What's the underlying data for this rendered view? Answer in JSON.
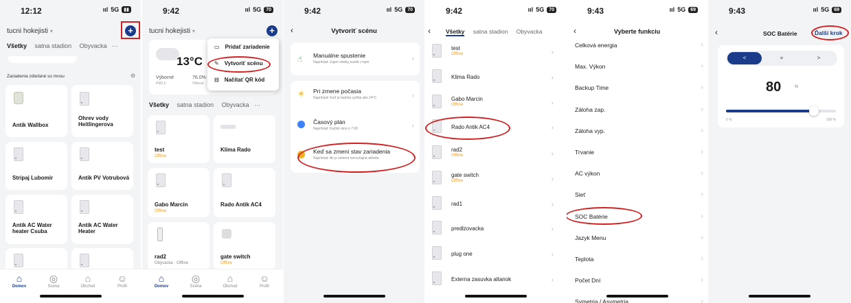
{
  "p1": {
    "time": "12:12",
    "net": "5G",
    "home_name": "tucni hokejisti",
    "tabs": [
      "Všetky",
      "satna stadion",
      "Obyvacka"
    ],
    "tab_more": "···",
    "shared_title": "Zariadenia zdieľané so mnou",
    "devices": [
      {
        "name": "Antik Wallbox"
      },
      {
        "name": "Ohrev vody Heitlingerova"
      },
      {
        "name": "Stripaj Lubomir"
      },
      {
        "name": "Antik PV Votrubová"
      },
      {
        "name": "Antik AC Water heater Csuba"
      },
      {
        "name": "Antik AC Water Heater"
      }
    ],
    "nav": [
      "Domov",
      "Scéna",
      "Obchod",
      "Profil"
    ]
  },
  "p2": {
    "time": "9:42",
    "net": "5G",
    "batt": "70",
    "home_name": "tucni hokejisti",
    "weather_temp": "13°C",
    "weather_l1": "Výborné",
    "weather_l2": "PM2,5",
    "weather_r1": "76.0%",
    "weather_r2": "Vlhkosť",
    "menu": [
      "Pridať zariadenie",
      "Vytvoriť scénu",
      "Načítať QR kód"
    ],
    "tabs": [
      "Všetky",
      "satna stadion",
      "Obyvacka"
    ],
    "tab_more": "···",
    "devices": [
      {
        "name": "test",
        "status": "Offline"
      },
      {
        "name": "Klima Rado",
        "status": ""
      },
      {
        "name": "Gabo Marcin",
        "status": "Offline"
      },
      {
        "name": "Rado Antik AC4",
        "status": ""
      },
      {
        "name": "rad2",
        "status": "Obývacka · Offline"
      },
      {
        "name": "gate switch",
        "status": "Offline"
      }
    ],
    "nav": [
      "Domov",
      "Scéna",
      "Obchod",
      "Profil"
    ]
  },
  "p3": {
    "time": "9:42",
    "net": "5G",
    "batt": "70",
    "title": "Vytvoriť scénu",
    "opt1_title": "Manuálne spustenie",
    "opt1_sub": "Napríklad: Zapni všetky svetlá v byte",
    "opt2_title": "Pri zmene počasia",
    "opt2_sub": "Napríklad: Keď je teplota vyššia ako 24°C",
    "opt3_title": "Časový plán",
    "opt3_sub": "Napríklad: Každé ráno o 7:00",
    "opt4_title": "Keď sa zmení stav zariadenia",
    "opt4_sub": "Napríklad: Ak je zistená nezvyčajná aktivita"
  },
  "p4": {
    "time": "9:42",
    "net": "5G",
    "batt": "70",
    "tabs": [
      "Všetky",
      "satna stadion",
      "Obyvacka"
    ],
    "devices": [
      {
        "name": "test",
        "status": "Offline"
      },
      {
        "name": "Klima Rado",
        "status": ""
      },
      {
        "name": "Gabo Marcin",
        "status": "Offline"
      },
      {
        "name": "Rado Antik AC4",
        "status": ""
      },
      {
        "name": "rad2",
        "status": "Offline"
      },
      {
        "name": "gate switch",
        "status": "Offline"
      },
      {
        "name": "rad1",
        "status": ""
      },
      {
        "name": "predlzovacka",
        "status": ""
      },
      {
        "name": "plug one",
        "status": ""
      },
      {
        "name": "Externa zasuvka altanok",
        "status": ""
      }
    ]
  },
  "p5": {
    "time": "9:43",
    "net": "5G",
    "batt": "69",
    "title": "Vyberte funkciu",
    "items": [
      "Celková energia",
      "Max. Výkon",
      "Backup Time",
      "Záloha zap.",
      "Záloha vyp.",
      "Trvanie",
      "AC výkon",
      "Sieť",
      "SOC Batérie",
      "Jazyk Menu",
      "Teplota",
      "Počet Dní",
      "Symetria / Asymetria"
    ]
  },
  "p6": {
    "time": "9:43",
    "net": "5G",
    "batt": "69",
    "title": "SOC Batérie",
    "next": "Ďalší krok",
    "ops": [
      "<",
      "=",
      ">"
    ],
    "value": "80",
    "unit": "%",
    "slider_level": 0.8,
    "min_label": "0 %",
    "max_label": "100 %"
  }
}
